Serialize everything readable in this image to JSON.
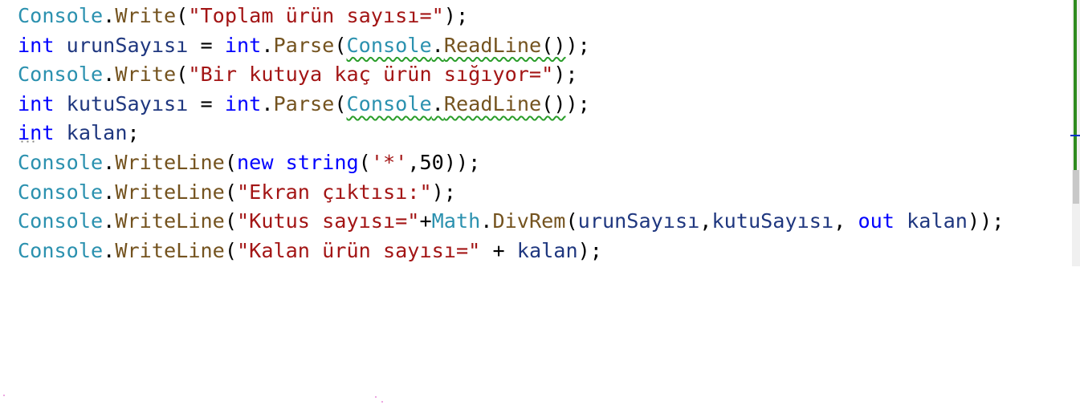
{
  "editor": {
    "language": "C#",
    "lines": [
      {
        "id": "line-1",
        "tokens": [
          {
            "text": "Console",
            "kind": "class"
          },
          {
            "text": ".",
            "kind": "punct"
          },
          {
            "text": "Write",
            "kind": "method"
          },
          {
            "text": "(",
            "kind": "punct"
          },
          {
            "text": "\"Toplam ürün sayısı=\"",
            "kind": "string"
          },
          {
            "text": ");",
            "kind": "punct"
          }
        ]
      },
      {
        "id": "line-2",
        "tokens": [
          {
            "text": "int",
            "kind": "keyword"
          },
          {
            "text": " ",
            "kind": "punct"
          },
          {
            "text": "urunSayısı",
            "kind": "ident"
          },
          {
            "text": " = ",
            "kind": "punct"
          },
          {
            "text": "int",
            "kind": "keyword"
          },
          {
            "text": ".",
            "kind": "punct"
          },
          {
            "text": "Parse",
            "kind": "method"
          },
          {
            "text": "(",
            "kind": "punct"
          },
          {
            "text": "Console",
            "kind": "class",
            "squiggle": true
          },
          {
            "text": ".",
            "kind": "punct",
            "squiggle": true
          },
          {
            "text": "ReadLine",
            "kind": "method",
            "squiggle": true
          },
          {
            "text": "()",
            "kind": "punct",
            "squiggle": true
          },
          {
            "text": ");",
            "kind": "punct"
          }
        ]
      },
      {
        "id": "line-3",
        "tokens": [
          {
            "text": "Console",
            "kind": "class"
          },
          {
            "text": ".",
            "kind": "punct"
          },
          {
            "text": "Write",
            "kind": "method"
          },
          {
            "text": "(",
            "kind": "punct"
          },
          {
            "text": "\"Bir kutuya kaç ürün sığıyor=\"",
            "kind": "string"
          },
          {
            "text": ");",
            "kind": "punct"
          }
        ]
      },
      {
        "id": "line-4",
        "tokens": [
          {
            "text": "int",
            "kind": "keyword"
          },
          {
            "text": " ",
            "kind": "punct"
          },
          {
            "text": "kutuSayısı",
            "kind": "ident"
          },
          {
            "text": " = ",
            "kind": "punct"
          },
          {
            "text": "int",
            "kind": "keyword"
          },
          {
            "text": ".",
            "kind": "punct"
          },
          {
            "text": "Parse",
            "kind": "method"
          },
          {
            "text": "(",
            "kind": "punct"
          },
          {
            "text": "Console",
            "kind": "class",
            "squiggle": true
          },
          {
            "text": ".",
            "kind": "punct",
            "squiggle": true
          },
          {
            "text": "ReadLine",
            "kind": "method",
            "squiggle": true
          },
          {
            "text": "()",
            "kind": "punct",
            "squiggle": true
          },
          {
            "text": ");",
            "kind": "punct"
          }
        ]
      },
      {
        "id": "line-5",
        "tokens": [
          {
            "text": "int",
            "kind": "keyword",
            "dots": true
          },
          {
            "text": " ",
            "kind": "punct"
          },
          {
            "text": "kalan",
            "kind": "ident"
          },
          {
            "text": ";",
            "kind": "punct"
          }
        ]
      },
      {
        "id": "line-6",
        "tokens": [
          {
            "text": "Console",
            "kind": "class"
          },
          {
            "text": ".",
            "kind": "punct"
          },
          {
            "text": "WriteLine",
            "kind": "method"
          },
          {
            "text": "(",
            "kind": "punct"
          },
          {
            "text": "new",
            "kind": "keyword"
          },
          {
            "text": " ",
            "kind": "punct"
          },
          {
            "text": "string",
            "kind": "keyword"
          },
          {
            "text": "(",
            "kind": "punct"
          },
          {
            "text": "'*'",
            "kind": "string"
          },
          {
            "text": ",",
            "kind": "punct"
          },
          {
            "text": "50",
            "kind": "number"
          },
          {
            "text": "));",
            "kind": "punct"
          }
        ]
      },
      {
        "id": "line-7",
        "tokens": [
          {
            "text": "Console",
            "kind": "class"
          },
          {
            "text": ".",
            "kind": "punct"
          },
          {
            "text": "WriteLine",
            "kind": "method"
          },
          {
            "text": "(",
            "kind": "punct"
          },
          {
            "text": "\"Ekran çıktısı:\"",
            "kind": "string"
          },
          {
            "text": ");",
            "kind": "punct"
          }
        ]
      },
      {
        "id": "line-8",
        "tokens": [
          {
            "text": "Console",
            "kind": "class"
          },
          {
            "text": ".",
            "kind": "punct"
          },
          {
            "text": "WriteLine",
            "kind": "method"
          },
          {
            "text": "(",
            "kind": "punct"
          },
          {
            "text": "\"Kutus sayısı=\"",
            "kind": "string"
          },
          {
            "text": "+",
            "kind": "punct"
          },
          {
            "text": "Math",
            "kind": "class"
          },
          {
            "text": ".",
            "kind": "punct"
          },
          {
            "text": "DivRem",
            "kind": "method"
          },
          {
            "text": "(",
            "kind": "punct"
          },
          {
            "text": "urunSayısı",
            "kind": "ident"
          },
          {
            "text": ",",
            "kind": "punct"
          },
          {
            "text": "kutuSayısı",
            "kind": "ident"
          },
          {
            "text": ", ",
            "kind": "punct"
          },
          {
            "text": "out",
            "kind": "keyword"
          },
          {
            "text": " ",
            "kind": "punct"
          },
          {
            "text": "kalan",
            "kind": "ident"
          },
          {
            "text": "));",
            "kind": "punct"
          }
        ]
      },
      {
        "id": "line-9",
        "tokens": [
          {
            "text": "Console",
            "kind": "class"
          },
          {
            "text": ".",
            "kind": "punct"
          },
          {
            "text": "WriteLine",
            "kind": "method"
          },
          {
            "text": "(",
            "kind": "punct"
          },
          {
            "text": "\"Kalan ürün sayısı=\"",
            "kind": "string"
          },
          {
            "text": " + ",
            "kind": "punct"
          },
          {
            "text": "kalan",
            "kind": "ident"
          },
          {
            "text": ");",
            "kind": "punct"
          }
        ]
      }
    ]
  },
  "colors": {
    "class": "#2b91af",
    "method": "#74531f",
    "string": "#a31515",
    "keyword": "#0000ff",
    "identifier": "#1f377f",
    "change_marker": "#2e8b1f",
    "warning_squiggle": "#2a9d2a"
  }
}
